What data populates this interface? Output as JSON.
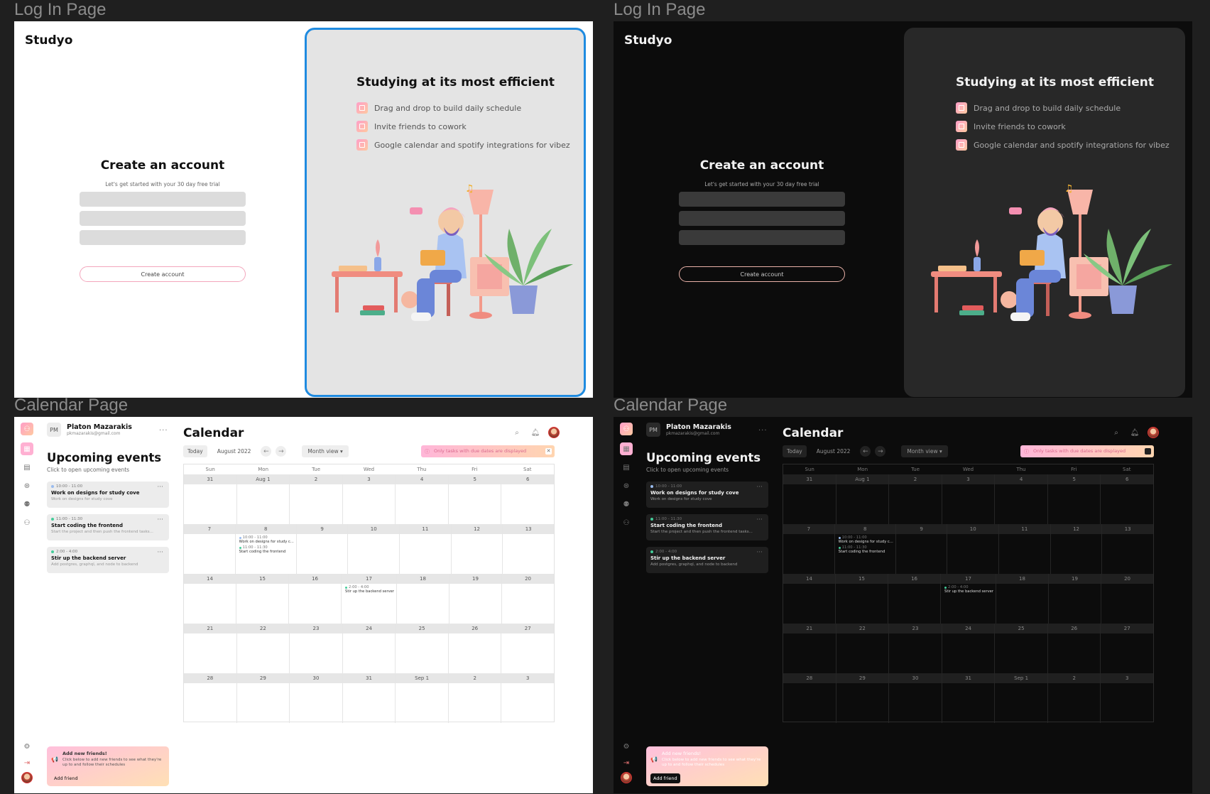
{
  "frame_labels": {
    "login_light": "Log In Page",
    "login_dark": "Log In Page",
    "cal_light": "Calendar Page",
    "cal_dark": "Calendar Page"
  },
  "login": {
    "brand": "Studyo",
    "title": "Create an account",
    "subtitle": "Let's get started with your 30 day free trial",
    "button": "Create account",
    "panel_title": "Studying at its most efficient",
    "features": [
      "Drag and drop to build daily schedule",
      "Invite friends to cowork",
      "Google calendar and spotify integrations for vibez"
    ]
  },
  "calendar": {
    "user": {
      "initials": "PM",
      "name": "Platon Mazarakis",
      "email": "pkmazarakis@gmail.com"
    },
    "upcoming_title": "Upcoming events",
    "upcoming_sub": "Click to open upcoming events",
    "events": [
      {
        "time": "10:00 - 11:00",
        "title": "Work on designs for study cove",
        "desc": "Work on designs for study cove"
      },
      {
        "time": "11:00 - 11:30",
        "title": "Start coding the frontend",
        "desc": "Start the project and then push the frontend tasks..."
      },
      {
        "time": "2:00 - 4:00",
        "title": "Stir up the backend server",
        "desc": "Add postgres, graphql, and node to backend"
      }
    ],
    "promo": {
      "title": "Add new friends!",
      "desc": "Click below to add new friends to see what they're up to and follow their schedules",
      "button": "Add friend"
    },
    "title": "Calendar",
    "today": "Today",
    "month": "August 2022",
    "view": "Month view",
    "notice": "Only tasks with due dates are displayed",
    "dow": [
      "Sun",
      "Mon",
      "Tue",
      "Wed",
      "Thu",
      "Fri",
      "Sat"
    ],
    "weeks": [
      [
        "31",
        "Aug 1",
        "2",
        "3",
        "4",
        "5",
        "6"
      ],
      [
        "7",
        "8",
        "9",
        "10",
        "11",
        "12",
        "13"
      ],
      [
        "14",
        "15",
        "16",
        "17",
        "18",
        "19",
        "20"
      ],
      [
        "21",
        "22",
        "23",
        "24",
        "25",
        "26",
        "27"
      ],
      [
        "28",
        "29",
        "30",
        "31",
        "Sep 1",
        "2",
        "3"
      ]
    ],
    "cell_events": {
      "w2_mon_1_time": "10:00 - 11:00",
      "w2_mon_1_title": "Work on designs for study c...",
      "w2_mon_2_time": "11:00 - 11:30",
      "w2_mon_2_title": "Start coding the frontend",
      "w3_wed_time": "2:00 - 4:00",
      "w3_wed_title": "Stir up the backend server"
    }
  },
  "colors": {
    "accent_pink": "#ffb0d2",
    "accent_peach": "#ffd5b0",
    "selection_blue": "#1f8be0"
  }
}
